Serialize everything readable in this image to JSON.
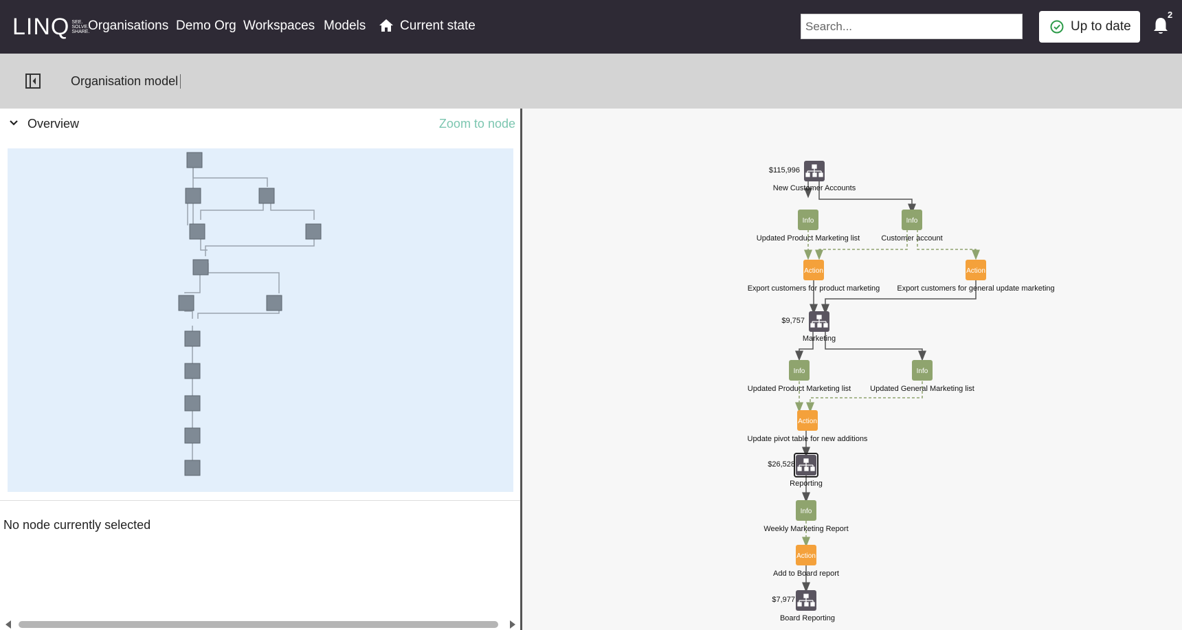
{
  "app": {
    "logo_text": "LINQ",
    "logo_tag": [
      "SEE.",
      "SOLVE.",
      "SHARE."
    ]
  },
  "nav": {
    "organisations": "Organisations",
    "demo_org": "Demo Org",
    "workspaces": "Workspaces",
    "models": "Models",
    "current_state": "Current state"
  },
  "search": {
    "placeholder": "Search..."
  },
  "status": {
    "label": "Up to date",
    "color": "#2e9c4a"
  },
  "notifications": {
    "count": "2"
  },
  "toolbar": {
    "model_title": "Organisation model"
  },
  "overview": {
    "label": "Overview",
    "zoom_link": "Zoom to node"
  },
  "details": {
    "empty_text": "No node currently selected"
  },
  "colors": {
    "org_node": "#5a5560",
    "info_node": "#8fa46e",
    "action_node": "#f4a13b",
    "minimap_bg": "#e3effb",
    "accent": "#7cc6b0"
  },
  "graph": {
    "nodes": [
      {
        "id": "n1",
        "type": "org",
        "name": "New Customer Accounts",
        "value": "$115,996"
      },
      {
        "id": "n2",
        "type": "info",
        "badge": "Info",
        "name": "Updated Product Marketing list"
      },
      {
        "id": "n3",
        "type": "info",
        "badge": "Info",
        "name": "Customer account"
      },
      {
        "id": "n4",
        "type": "action",
        "badge": "Action",
        "name": "Export customers for product marketing"
      },
      {
        "id": "n5",
        "type": "action",
        "badge": "Action",
        "name": "Export customers for general update marketing"
      },
      {
        "id": "n6",
        "type": "org",
        "name": "Marketing",
        "value": "$9,757"
      },
      {
        "id": "n7",
        "type": "info",
        "badge": "Info",
        "name": "Updated Product Marketing list"
      },
      {
        "id": "n8",
        "type": "info",
        "badge": "Info",
        "name": "Updated General Marketing list"
      },
      {
        "id": "n9",
        "type": "action",
        "badge": "Action",
        "name": "Update pivot table for new additions"
      },
      {
        "id": "n10",
        "type": "org",
        "name": "Reporting",
        "value": "$26,528",
        "selected": true
      },
      {
        "id": "n11",
        "type": "info",
        "badge": "Info",
        "name": "Weekly Marketing Report"
      },
      {
        "id": "n12",
        "type": "action",
        "badge": "Action",
        "name": "Add to Board report"
      },
      {
        "id": "n13",
        "type": "org",
        "name": "Board Reporting",
        "value": "$7,977"
      }
    ]
  }
}
